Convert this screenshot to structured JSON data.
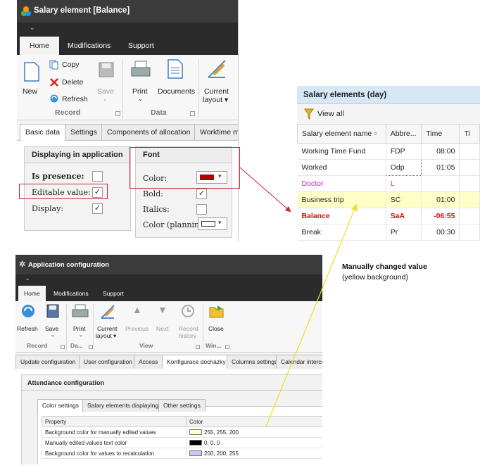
{
  "salary_window": {
    "title": "Salary element [Balance]",
    "qat_glyph": "⌄",
    "tabs": [
      "Home",
      "Modifications",
      "Support"
    ],
    "active_tab": "Home",
    "buttons": {
      "new": "New",
      "copy": "Copy",
      "delete": "Delete",
      "refresh": "Refresh",
      "save": "Save",
      "print": "Print",
      "documents": "Documents",
      "current_layout_1": "Current",
      "current_layout_2": "layout ▾"
    },
    "groups": {
      "record": "Record",
      "data": "Data"
    },
    "content_tabs": [
      "Basic data",
      "Settings",
      "Components of allocation",
      "Worktime mo"
    ],
    "display_group": {
      "title": "Displaying in application",
      "is_presence": "Is presence:",
      "editable_value": "Editable value:",
      "display": "Display:",
      "is_presence_checked": false,
      "editable_value_checked": true,
      "display_checked": true
    },
    "font_group": {
      "title": "Font",
      "color": "Color:",
      "bold": "Bold:",
      "italics": "Italics:",
      "color_planning": "Color (planning):",
      "bold_checked": true,
      "italics_checked": false,
      "font_color": "#b00000"
    }
  },
  "salary_grid": {
    "title": "Salary elements (day)",
    "view_all": "View all",
    "columns": [
      "Salary element name",
      "Abbre...",
      "Time",
      "Ti"
    ],
    "rows": [
      {
        "name": "Working Time Fund",
        "abbr": "FDP",
        "time": "08:00",
        "style": "normal"
      },
      {
        "name": "Worked",
        "abbr": "Odp",
        "time": "01:05",
        "style": "normal"
      },
      {
        "name": "Doctor",
        "abbr": "L",
        "time": "",
        "style": "magenta"
      },
      {
        "name": "Business trip",
        "abbr": "SC",
        "time": "01:00",
        "style": "yellow"
      },
      {
        "name": "Balance",
        "abbr": "SaA",
        "time": "-06:55",
        "style": "red"
      },
      {
        "name": "Break",
        "abbr": "Pr",
        "time": "00:30",
        "style": "normal"
      }
    ]
  },
  "annotation": {
    "line1": "Manually changed value",
    "line2": "(yellow background)"
  },
  "config_window": {
    "title": "Application configuration",
    "qat_glyph": "⌄",
    "tabs": [
      "Home",
      "Modifications",
      "Support"
    ],
    "buttons": {
      "refresh": "Refresh",
      "save": "Save",
      "print": "Print",
      "current_layout_1": "Current",
      "current_layout_2": "layout ▾",
      "previous": "Previous",
      "next": "Next",
      "record_history_1": "Record",
      "record_history_2": "history",
      "close": "Close"
    },
    "groups": {
      "record": "Record",
      "data": "Da...",
      "view": "View",
      "window": "Win..."
    },
    "content_tabs": [
      "Update configuration",
      "User configuration",
      "Access",
      "Konfigurace docházky",
      "Columns settings",
      "Calendar interco"
    ],
    "section_title": "Attendance configuration",
    "sub_tabs": [
      "Color settings",
      "Salary elements displaying",
      "Other settings"
    ],
    "table": {
      "headers": [
        "Property",
        "Color"
      ],
      "rows": [
        {
          "property": "Background color for manually edited values",
          "color": "255, 255, 200",
          "swatch": "#ffffc8"
        },
        {
          "property": "Manually edited values text color",
          "color": "0, 0, 0",
          "swatch": "#000000"
        },
        {
          "property": "Background color for values to recalculation",
          "color": "200, 200, 255",
          "swatch": "#c8c8ff"
        }
      ]
    }
  }
}
